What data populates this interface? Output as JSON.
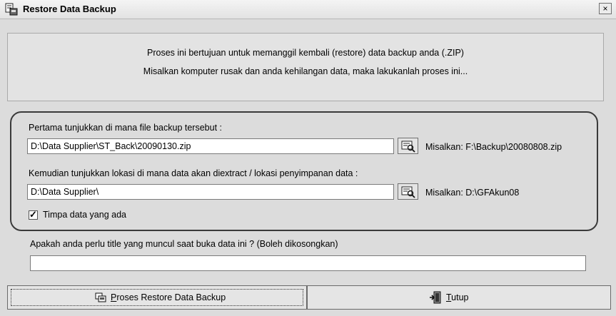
{
  "window": {
    "title": "Restore Data Backup",
    "close_label": "×"
  },
  "info": {
    "line1": "Proses ini bertujuan untuk memanggil kembali (restore) data backup anda (.ZIP)",
    "line2": "Misalkan komputer rusak dan anda kehilangan data, maka lakukanlah proses ini..."
  },
  "backup_file": {
    "label": "Pertama tunjukkan di mana file backup tersebut :",
    "value": "D:\\Data Supplier\\ST_Back\\20090130.zip",
    "example": "Misalkan: F:\\Backup\\20080808.zip"
  },
  "extract_location": {
    "label": "Kemudian tunjukkan lokasi di mana data akan diextract / lokasi penyimpanan data :",
    "value": "D:\\Data Supplier\\",
    "example": "Misalkan: D:\\GFAkun08"
  },
  "overwrite": {
    "label": "Timpa data yang ada",
    "checked": true
  },
  "title_field": {
    "label": "Apakah anda perlu title yang muncul saat buka data ini ? (Boleh dikosongkan)",
    "value": ""
  },
  "buttons": {
    "restore_accel": "P",
    "restore_rest": "roses Restore Data Backup",
    "close_accel": "T",
    "close_rest": "utup"
  }
}
